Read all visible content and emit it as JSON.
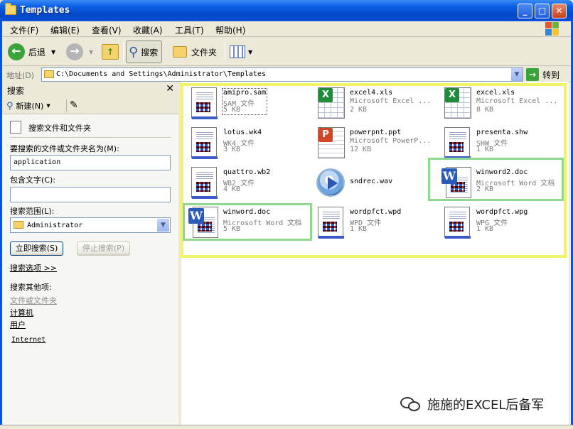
{
  "window": {
    "title": "Templates"
  },
  "menu": [
    {
      "label": "文件(F)"
    },
    {
      "label": "编辑(E)"
    },
    {
      "label": "查看(V)"
    },
    {
      "label": "收藏(A)"
    },
    {
      "label": "工具(T)"
    },
    {
      "label": "帮助(H)"
    }
  ],
  "toolbar": {
    "back_label": "后退",
    "search_label": "搜索",
    "folders_label": "文件夹"
  },
  "address": {
    "label": "地址(D)",
    "path": "C:\\Documents and Settings\\Administrator\\Templates",
    "go_label": "转到"
  },
  "search_pane": {
    "title": "搜索",
    "new_label": "新建(N)",
    "heading": "搜索文件和文件夹",
    "name_label": "要搜索的文件或文件夹名为(M):",
    "name_value": "application",
    "text_label": "包含文字(C):",
    "text_value": "",
    "scope_label": "搜索范围(L):",
    "scope_value": "Administrator",
    "search_now": "立即搜索(S)",
    "stop_search": "停止搜索(P)",
    "options_link": "搜索选项 >>",
    "other_heading": "搜索其他项:",
    "other_files": "文件或文件夹",
    "other_computer": "计算机",
    "other_people": "用户",
    "internet": "Internet"
  },
  "files": [
    {
      "name": "amipro.sam",
      "type": "SAM 文件",
      "size": "5 KB",
      "icon": "document-icon"
    },
    {
      "name": "excel4.xls",
      "type": "Microsoft Excel ...",
      "size": "2 KB",
      "icon": "excel-icon"
    },
    {
      "name": "excel.xls",
      "type": "Microsoft Excel ...",
      "size": "8 KB",
      "icon": "excel-icon"
    },
    {
      "name": "lotus.wk4",
      "type": "WK4 文件",
      "size": "3 KB",
      "icon": "document-icon"
    },
    {
      "name": "powerpnt.ppt",
      "type": "Microsoft PowerP...",
      "size": "12 KB",
      "icon": "powerpoint-icon"
    },
    {
      "name": "presenta.shw",
      "type": "SHW 文件",
      "size": "1 KB",
      "icon": "document-icon"
    },
    {
      "name": "quattro.wb2",
      "type": "WB2 文件",
      "size": "4 KB",
      "icon": "document-icon"
    },
    {
      "name": "sndrec.wav",
      "type": "",
      "size": "",
      "icon": "media-player-icon"
    },
    {
      "name": "winword2.doc",
      "type": "Microsoft Word 文档",
      "size": "2 KB",
      "icon": "word-icon"
    },
    {
      "name": "winword.doc",
      "type": "Microsoft Word 文档",
      "size": "5 KB",
      "icon": "word-icon"
    },
    {
      "name": "wordpfct.wpd",
      "type": "WPD 文件",
      "size": "1 KB",
      "icon": "document-icon"
    },
    {
      "name": "wordpfct.wpg",
      "type": "WPG 文件",
      "size": "1 KB",
      "icon": "document-icon"
    }
  ],
  "watermark": {
    "text": "施施的EXCEL后备军"
  },
  "colors": {
    "highlight_yellow": "#F3F36A",
    "highlight_green": "#8ED98E",
    "titlebar_blue": "#0A5FE6"
  }
}
